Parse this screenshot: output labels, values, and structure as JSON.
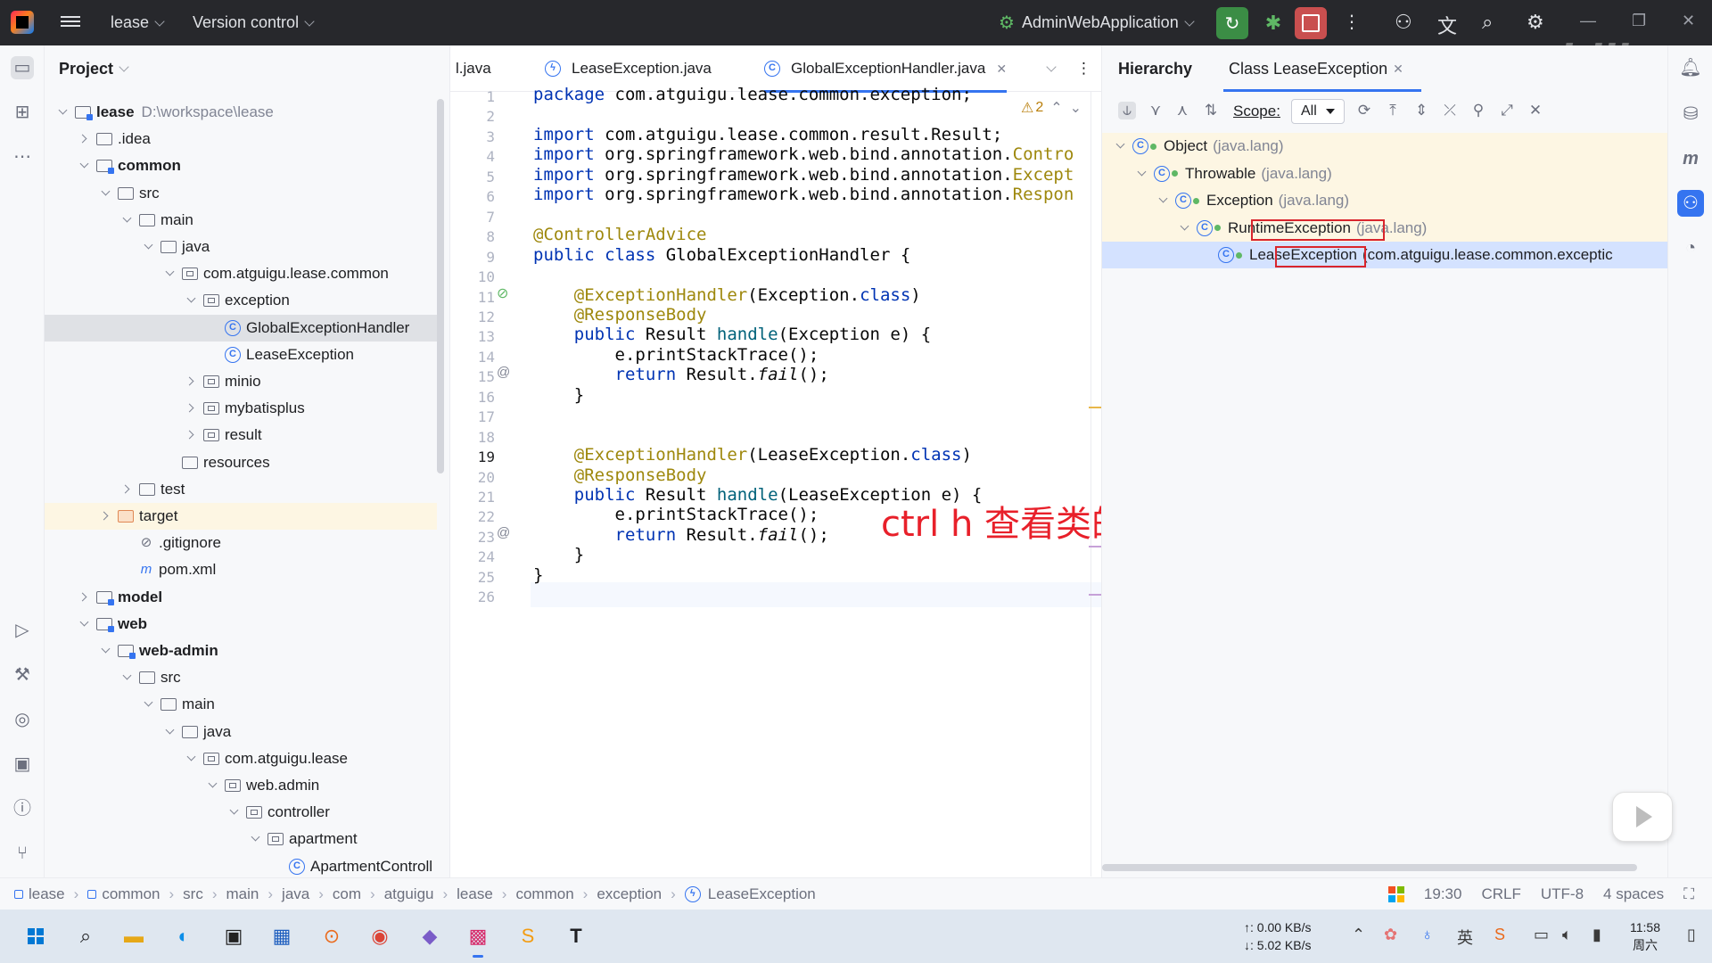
{
  "titlebar": {
    "project_name": "lease",
    "vcs_label": "Version control",
    "run_config": "AdminWebApplication"
  },
  "project_panel": {
    "title": "Project",
    "tree": [
      {
        "label": "lease",
        "path": "D:\\workspace\\lease",
        "level": 0,
        "type": "module",
        "expanded": true,
        "bold": true
      },
      {
        "label": ".idea",
        "level": 1,
        "type": "folder",
        "expanded": false
      },
      {
        "label": "common",
        "level": 1,
        "type": "module",
        "expanded": true,
        "bold": true
      },
      {
        "label": "src",
        "level": 2,
        "type": "folder",
        "expanded": true
      },
      {
        "label": "main",
        "level": 3,
        "type": "folder",
        "expanded": true
      },
      {
        "label": "java",
        "level": 4,
        "type": "folder",
        "expanded": true
      },
      {
        "label": "com.atguigu.lease.common",
        "level": 5,
        "type": "pkg",
        "expanded": true
      },
      {
        "label": "exception",
        "level": 6,
        "type": "pkg",
        "expanded": true
      },
      {
        "label": "GlobalExceptionHandler",
        "level": 7,
        "type": "class",
        "selected": true
      },
      {
        "label": "LeaseException",
        "level": 7,
        "type": "class"
      },
      {
        "label": "minio",
        "level": 6,
        "type": "pkg",
        "expanded": false
      },
      {
        "label": "mybatisplus",
        "level": 6,
        "type": "pkg",
        "expanded": false
      },
      {
        "label": "result",
        "level": 6,
        "type": "pkg",
        "expanded": false
      },
      {
        "label": "resources",
        "level": 5,
        "type": "folder"
      },
      {
        "label": "test",
        "level": 3,
        "type": "folder",
        "expanded": false
      },
      {
        "label": "target",
        "level": 2,
        "type": "orange",
        "expanded": false,
        "highlight": true
      },
      {
        "label": ".gitignore",
        "level": 3,
        "type": "gitignore"
      },
      {
        "label": "pom.xml",
        "level": 3,
        "type": "maven"
      },
      {
        "label": "model",
        "level": 1,
        "type": "module",
        "expanded": false,
        "bold": true
      },
      {
        "label": "web",
        "level": 1,
        "type": "module",
        "expanded": true,
        "bold": true
      },
      {
        "label": "web-admin",
        "level": 2,
        "type": "module",
        "expanded": true,
        "bold": true
      },
      {
        "label": "src",
        "level": 3,
        "type": "folder",
        "expanded": true
      },
      {
        "label": "main",
        "level": 4,
        "type": "folder",
        "expanded": true
      },
      {
        "label": "java",
        "level": 5,
        "type": "folder",
        "expanded": true
      },
      {
        "label": "com.atguigu.lease",
        "level": 6,
        "type": "pkg",
        "expanded": true
      },
      {
        "label": "web.admin",
        "level": 7,
        "type": "pkg",
        "expanded": true
      },
      {
        "label": "controller",
        "level": 8,
        "type": "pkg",
        "expanded": true
      },
      {
        "label": "apartment",
        "level": 9,
        "type": "pkg",
        "expanded": true
      },
      {
        "label": "ApartmentControll",
        "level": 10,
        "type": "class"
      }
    ]
  },
  "editor": {
    "tabs": [
      {
        "label": "l.java"
      },
      {
        "label": "LeaseException.java"
      },
      {
        "label": "GlobalExceptionHandler.java",
        "active": true
      }
    ],
    "warning_count": "2",
    "current_line": 19,
    "lines": [
      {
        "n": "1",
        "html": "<span class=\"kw\">package</span> com.atguigu.lease.common.exception;"
      },
      {
        "n": "2",
        "html": ""
      },
      {
        "n": "3",
        "html": "<span class=\"kw\">import</span> com.atguigu.lease.common.result.Result;"
      },
      {
        "n": "4",
        "html": "<span class=\"kw\">import</span> org.springframework.web.bind.annotation.<span class=\"ann\">Contro</span>"
      },
      {
        "n": "5",
        "html": "<span class=\"kw\">import</span> org.springframework.web.bind.annotation.<span class=\"ann\">Except</span>"
      },
      {
        "n": "6",
        "html": "<span class=\"kw\">import</span> org.springframework.web.bind.annotation.<span class=\"ann\">Respon</span>"
      },
      {
        "n": "7",
        "html": ""
      },
      {
        "n": "8",
        "html": "<span class=\"ann\">@ControllerAdvice</span>"
      },
      {
        "n": "9",
        "html": "<span class=\"kw\">public class</span> GlobalExceptionHandler {"
      },
      {
        "n": "10",
        "html": ""
      },
      {
        "n": "11",
        "html": "    <span class=\"ann\">@ExceptionHandler</span>(Exception.<span class=\"kw\">class</span>)"
      },
      {
        "n": "12",
        "html": "    <span class=\"ann\">@ResponseBody</span>"
      },
      {
        "n": "13",
        "html": "    <span class=\"kw\">public</span> Result <span class=\"fn\">handle</span>(Exception e) {"
      },
      {
        "n": "14",
        "html": "        e.printStackTrace();"
      },
      {
        "n": "15",
        "html": "        <span class=\"kw\">return</span> Result.<span class=\"it\">fail</span>();"
      },
      {
        "n": "16",
        "html": "    }"
      },
      {
        "n": "17",
        "html": ""
      },
      {
        "n": "18",
        "html": ""
      },
      {
        "n": "19",
        "html": "    <span class=\"ann\">@ExceptionHandler</span>(LeaseException.<span class=\"kw\">class</span>)"
      },
      {
        "n": "20",
        "html": "    <span class=\"ann\">@ResponseBody</span>"
      },
      {
        "n": "21",
        "html": "    <span class=\"kw\">public</span> Result <span class=\"fn\">handle</span>(LeaseException e) {"
      },
      {
        "n": "22",
        "html": "        e.printStackTrace();"
      },
      {
        "n": "23",
        "html": "        <span class=\"kw\">return</span> Result.<span class=\"it\">fail</span>();"
      },
      {
        "n": "24",
        "html": "    }"
      },
      {
        "n": "25",
        "html": "}"
      },
      {
        "n": "26",
        "html": ""
      }
    ]
  },
  "caption": "ctrl h 查看类的继承关系",
  "hierarchy": {
    "title": "Hierarchy",
    "tab_label": "Class LeaseException",
    "scope_label": "Scope:",
    "scope_value": "All",
    "rows": [
      {
        "name": "Object",
        "pkg": "(java.lang)",
        "level": 0
      },
      {
        "name": "Throwable",
        "pkg": "(java.lang)",
        "level": 1
      },
      {
        "name": "Exception",
        "pkg": "(java.lang)",
        "level": 2
      },
      {
        "name": "RuntimeException",
        "pkg": "(java.lang)",
        "level": 3
      },
      {
        "name": "LeaseException",
        "pkg": "(com.atguigu.lease.common.exceptic",
        "level": 4,
        "selected": true
      }
    ]
  },
  "breadcrumb": [
    "lease",
    "common",
    "src",
    "main",
    "java",
    "com",
    "atguigu",
    "lease",
    "common",
    "exception",
    "LeaseException"
  ],
  "status": {
    "position": "19:30",
    "line_sep": "CRLF",
    "encoding": "UTF-8",
    "indent": "4 spaces"
  },
  "taskbar": {
    "net_up": "↑: 0.00 KB/s",
    "net_down": "↓: 5.02 KB/s",
    "time": "11:58",
    "day": "周六"
  }
}
